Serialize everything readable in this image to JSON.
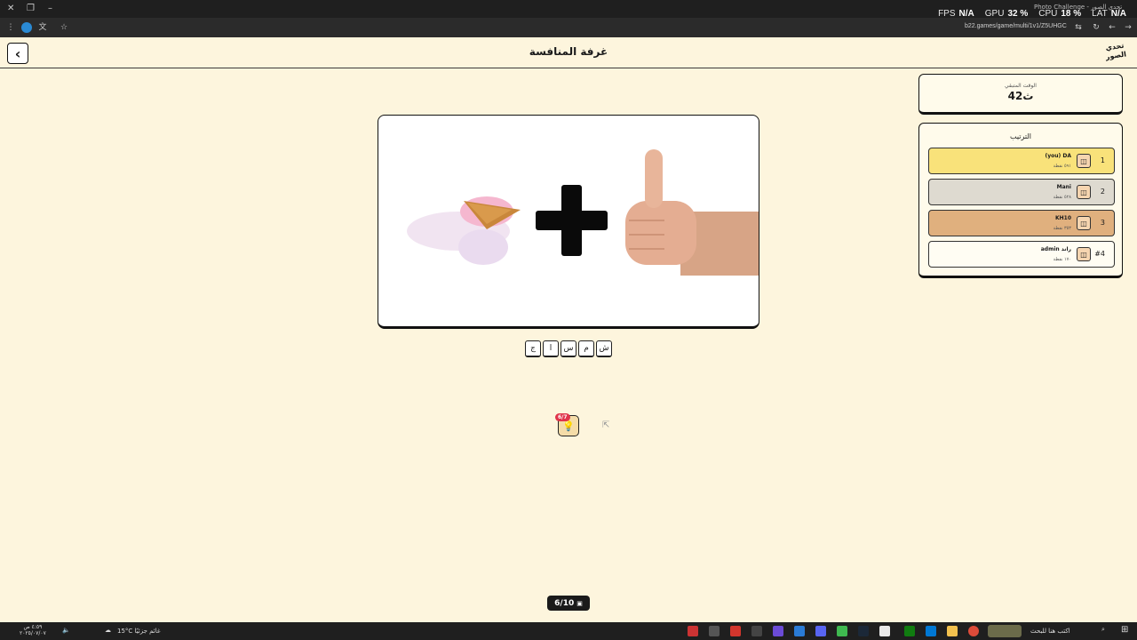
{
  "browser": {
    "tab_title": "Photo Challenge - تحدي الصور",
    "url": "b22.games/game/multi/1v1/Z5UHGC",
    "overlay": {
      "fps_label": "FPS",
      "fps": "N/A",
      "gpu_label": "GPU",
      "gpu": "32 %",
      "cpu_label": "CPU",
      "cpu": "18 %",
      "lat_label": "LAT",
      "lat": "N/A"
    }
  },
  "header": {
    "title": "غرفة المنافسة",
    "logo_text": "تحدي الصور"
  },
  "timer": {
    "label": "الوقت المتبقي",
    "value": "42ث"
  },
  "ranking": {
    "title": "الترتيب",
    "rows": [
      {
        "pos": "1",
        "name": "(you) DA",
        "score": "٥٩١ نقطة",
        "color": "#f9e27a"
      },
      {
        "pos": "2",
        "name": "Mani",
        "score": "٥٢٨ نقطة",
        "color": "#dedad0"
      },
      {
        "pos": "3",
        "name": "KH10",
        "score": "٣٥٣ نقطة",
        "color": "#e0b07e"
      },
      {
        "pos": "#4",
        "name": "admin راند",
        "score": "١٧٠ نقطة",
        "color": "#fffdf3"
      }
    ]
  },
  "letters": [
    "ج",
    "ا",
    "س",
    "م",
    "ش"
  ],
  "hint": {
    "badge": "6/7"
  },
  "round": {
    "text": "6/10"
  },
  "taskbar": {
    "weather": "15°C غائم جزئيًا",
    "search": "اكتب هنا للبحث",
    "time": "٤:٥٩ ص",
    "date": "٢٠٢٥/٠٧/٠٧"
  },
  "colors": {
    "background": "#fdf5dd",
    "badge": "#e0344a",
    "first": "#f9e27a",
    "second": "#dedad0",
    "third": "#e0b07e"
  }
}
